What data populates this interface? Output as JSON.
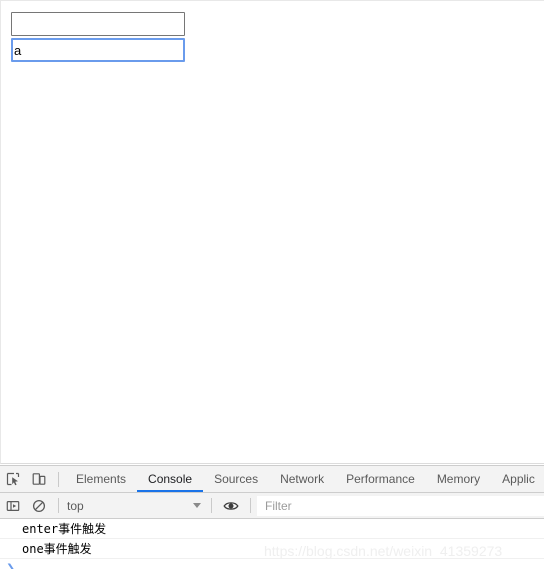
{
  "page": {
    "inputs": [
      {
        "name": "first-input",
        "value": "",
        "placeholder": "",
        "focused": false
      },
      {
        "name": "second-input",
        "value": "a",
        "placeholder": "",
        "focused": true
      }
    ]
  },
  "devtools": {
    "icons": {
      "inspect": "inspect-element-icon",
      "device": "device-toolbar-icon",
      "sidebar": "console-sidebar-icon",
      "clear": "clear-console-icon",
      "eye": "live-expression-icon",
      "caret": "chevron-down-icon",
      "prompt": "console-prompt-arrow-icon"
    },
    "tabs": [
      {
        "label": "Elements",
        "active": false
      },
      {
        "label": "Console",
        "active": true
      },
      {
        "label": "Sources",
        "active": false
      },
      {
        "label": "Network",
        "active": false
      },
      {
        "label": "Performance",
        "active": false
      },
      {
        "label": "Memory",
        "active": false
      },
      {
        "label": "Applic",
        "active": false
      }
    ],
    "toolbar": {
      "context": "top",
      "filter_placeholder": "Filter"
    },
    "console_messages": [
      "enter事件触发",
      "one事件触发"
    ],
    "prompt_symbol": "❯"
  },
  "watermark": {
    "text": "https://blog.csdn.net/weixin_41359273"
  },
  "colors": {
    "accent": "#1a73e8",
    "focus_border": "#6a9bec",
    "toolbar_bg": "#f3f3f3"
  }
}
